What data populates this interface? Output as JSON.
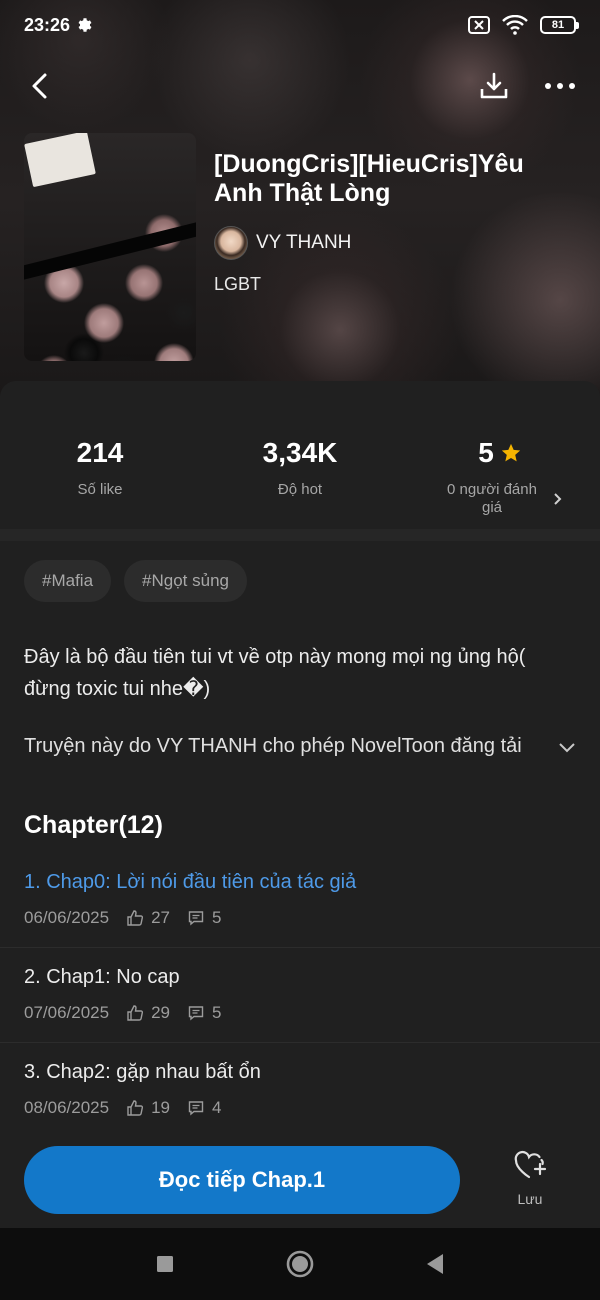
{
  "status_bar": {
    "time": "23:26",
    "battery": "81",
    "icons": [
      "gear-icon",
      "sim-off-icon",
      "wifi-icon",
      "battery-icon"
    ]
  },
  "nav": {
    "icons": [
      "back-arrow-icon",
      "download-icon",
      "more-icon"
    ]
  },
  "story": {
    "title": "[DuongCris][HieuCris]Yêu Anh Thật Lòng",
    "author": "VY THANH",
    "genre": "LGBT"
  },
  "stats": {
    "likes_value": "214",
    "likes_label": "Số like",
    "hot_value": "3,34K",
    "hot_label": "Độ hot",
    "rating_value": "5",
    "rating_label": "0 người đánh giá"
  },
  "tags": [
    "#Mafia",
    "#Ngọt sủng"
  ],
  "description": "Đây là bộ đầu tiên tui vt về otp này mong mọi ng ủng hộ( đừng toxic tui nhe�)",
  "license": "Truyện này do VY THANH cho phép NovelToon đăng tải",
  "chapter_heading": "Chapter(12)",
  "chapters": [
    {
      "title": "1. Chap0: Lời nói đầu tiên của tác giả",
      "date": "06/06/2025",
      "likes": "27",
      "comments": "5"
    },
    {
      "title": "2. Chap1: No cap",
      "date": "07/06/2025",
      "likes": "29",
      "comments": "5"
    },
    {
      "title": "3. Chap2: gặp nhau bất ổn",
      "date": "08/06/2025",
      "likes": "19",
      "comments": "4"
    }
  ],
  "actions": {
    "read_label": "Đọc tiếp Chap.1",
    "save_label": "Lưu"
  },
  "colors": {
    "accent": "#1378c9",
    "link": "#4e9ae8",
    "star": "#f5b400",
    "sheet_bg": "#202020"
  }
}
